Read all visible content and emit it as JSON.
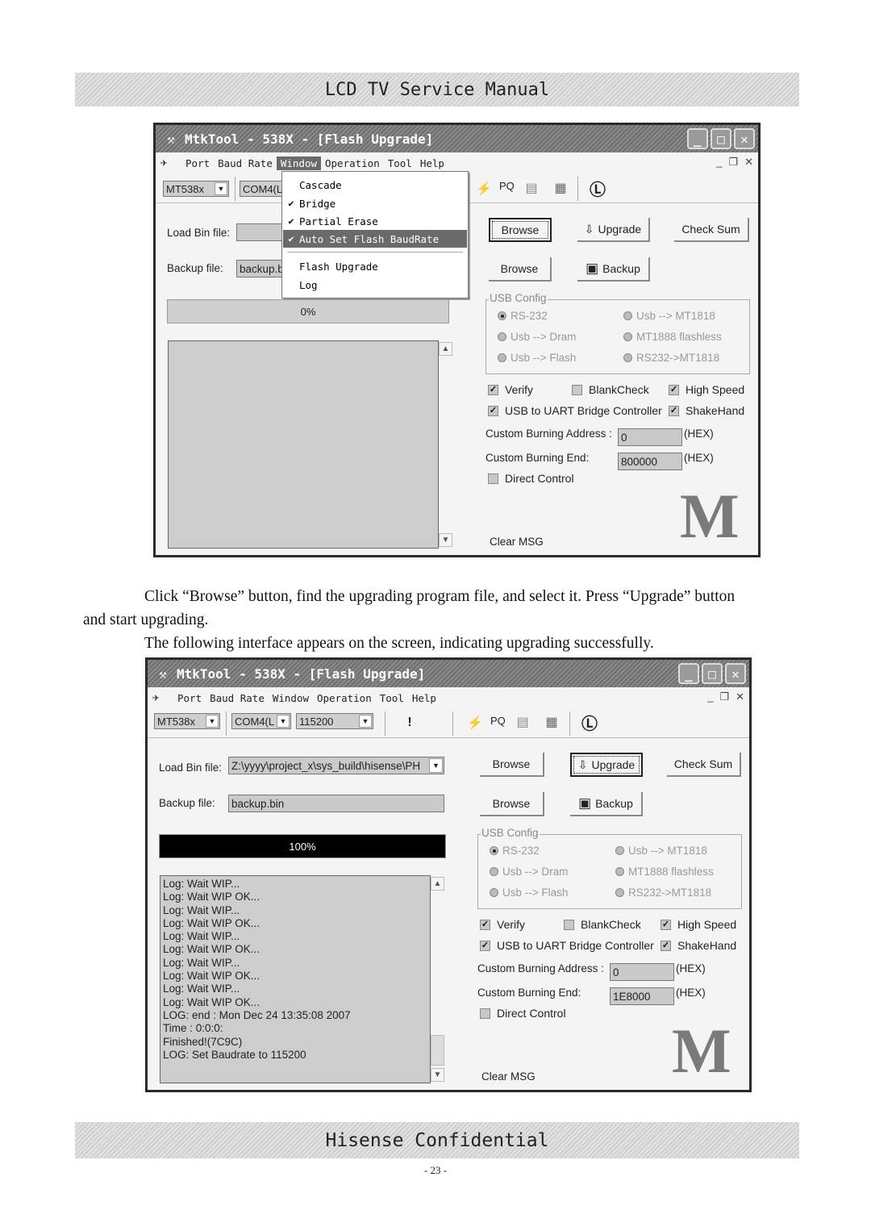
{
  "header_band": "LCD TV Service Manual",
  "footer_band": "Hisense Confidential",
  "page_number": "- 23 -",
  "paragraphs": {
    "p1_line1": "Click “Browse” button, find the upgrading program file, and select it. Press “Upgrade” button",
    "p1_line2": "and start upgrading.",
    "p2": "The following interface appears on the screen, indicating upgrading successfully."
  },
  "window1": {
    "title": "MtkTool - 538X - [Flash Upgrade]",
    "menu": [
      "Port",
      "Baud Rate",
      "Window",
      "Operation",
      "Tool",
      "Help"
    ],
    "active_menu": "Window",
    "chip_combo": "MT538x",
    "port_combo": "COM4(L",
    "toolbar_pq": "PQ",
    "load_bin_label": "Load Bin file:",
    "load_bin_value": "",
    "backup_label": "Backup file:",
    "backup_value": "backup.b",
    "browse_label": "Browse",
    "upgrade_label": "Upgrade",
    "checksum_label": "Check Sum",
    "backup_btn_label": "Backup",
    "progress_text": "0%",
    "progress_value": 0,
    "log_lines": [],
    "dropdown": [
      {
        "label": "Cascade",
        "checked": false
      },
      {
        "label": "Bridge",
        "checked": true
      },
      {
        "label": "Partial Erase",
        "checked": true
      },
      {
        "label": "Auto Set Flash BaudRate",
        "checked": true,
        "highlighted": true
      },
      {
        "label": "Flash Upgrade",
        "checked": false
      },
      {
        "label": "Log",
        "checked": false
      }
    ],
    "usb_config": {
      "title": "USB Config",
      "options": [
        "RS-232",
        "Usb --> MT1818",
        "Usb --> Dram",
        "MT1888 flashless",
        "Usb --> Flash",
        "RS232->MT1818"
      ],
      "selected": "RS-232"
    },
    "checks": {
      "verify": {
        "label": "Verify",
        "checked": true
      },
      "blankcheck": {
        "label": "BlankCheck",
        "checked": false
      },
      "highspeed": {
        "label": "High Speed",
        "checked": true
      },
      "usb_uart": {
        "label": "USB to UART Bridge Controller",
        "checked": true
      },
      "shakehand": {
        "label": "ShakeHand",
        "checked": true
      },
      "direct": {
        "label": "Direct Control",
        "checked": false
      }
    },
    "addr_label": "Custom Burning  Address :",
    "addr_value": "0",
    "end_label": "Custom Burning  End:",
    "end_value": "800000",
    "hex_label": "(HEX)",
    "clear_msg": "Clear MSG",
    "logo": "M"
  },
  "window2": {
    "title": "MtkTool - 538X - [Flash Upgrade]",
    "menu": [
      "Port",
      "Baud Rate",
      "Window",
      "Operation",
      "Tool",
      "Help"
    ],
    "chip_combo": "MT538x",
    "port_combo": "COM4(L",
    "baud_combo": "115200",
    "toolbar_alert": "!",
    "toolbar_pq": "PQ",
    "load_bin_label": "Load Bin file:",
    "load_bin_value": "Z:\\yyyy\\project_x\\sys_build\\hisense\\PH",
    "backup_label": "Backup file:",
    "backup_value": "backup.bin",
    "browse_label": "Browse",
    "upgrade_label": "Upgrade",
    "checksum_label": "Check Sum",
    "backup_btn_label": "Backup",
    "progress_text": "100%",
    "progress_value": 100,
    "log_lines": [
      "Log: Wait WIP...",
      "Log: Wait WIP OK...",
      "Log: Wait WIP...",
      "Log: Wait WIP OK...",
      "Log: Wait WIP...",
      "Log: Wait WIP OK...",
      "Log: Wait WIP...",
      "Log: Wait WIP OK...",
      "Log: Wait WIP...",
      "Log: Wait WIP OK...",
      "LOG: end : Mon Dec 24 13:35:08 2007",
      "Time : 0:0:0:",
      "Finished!(7C9C)",
      "LOG: Set Baudrate to 115200"
    ],
    "usb_config": {
      "title": "USB Config",
      "options": [
        "RS-232",
        "Usb --> MT1818",
        "Usb --> Dram",
        "MT1888 flashless",
        "Usb --> Flash",
        "RS232->MT1818"
      ],
      "selected": "RS-232"
    },
    "checks": {
      "verify": {
        "label": "Verify",
        "checked": true
      },
      "blankcheck": {
        "label": "BlankCheck",
        "checked": false
      },
      "highspeed": {
        "label": "High Speed",
        "checked": true
      },
      "usb_uart": {
        "label": "USB to UART Bridge Controller",
        "checked": true
      },
      "shakehand": {
        "label": "ShakeHand",
        "checked": true
      },
      "direct": {
        "label": "Direct Control",
        "checked": false
      }
    },
    "addr_label": "Custom Burning  Address :",
    "addr_value": "0",
    "end_label": "Custom Burning  End:",
    "end_value": "1E8000",
    "hex_label": "(HEX)",
    "clear_msg": "Clear MSG",
    "logo": "M"
  }
}
